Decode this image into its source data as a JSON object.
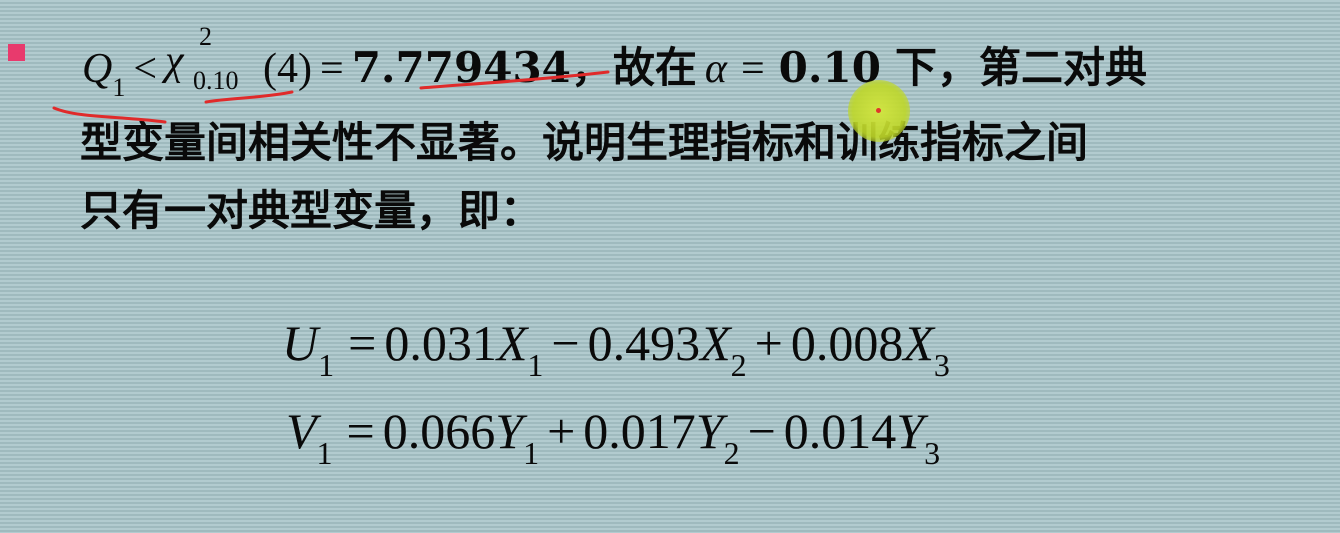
{
  "slide": {
    "line1": {
      "q": "Q",
      "q_sub": "1",
      "lt": "<",
      "chi": "χ",
      "chi_sup": "2",
      "chi_sub": "0.10",
      "arg": "(4)",
      "eq": "=",
      "value": "7.779434",
      "text_a": "，故在",
      "alpha": "α",
      "eq2": "=",
      "alpha_value": "0.10",
      "text_b": "下，第二对典"
    },
    "line2": "型变量间相关性不显著。说明生理指标和训练指标之间",
    "line3": "只有一对典型变量，即：",
    "eq1": {
      "lhs": "U",
      "lhs_sub": "1",
      "eq": "=",
      "t1": "0.031",
      "v1": "X",
      "s1": "1",
      "op1": "−",
      "t2": "0.493",
      "v2": "X",
      "s2": "2",
      "op2": "+",
      "t3": "0.008",
      "v3": "X",
      "s3": "3"
    },
    "eq2": {
      "lhs": "V",
      "lhs_sub": "1",
      "eq": "=",
      "t1": "0.066",
      "v1": "Y",
      "s1": "1",
      "op1": "+",
      "t2": "0.017",
      "v2": "Y",
      "s2": "2",
      "op2": "−",
      "t3": "0.014",
      "v3": "Y",
      "s3": "3"
    }
  },
  "colors": {
    "bullet": "#e83a6d",
    "ink_annotation": "#e02a2a",
    "pointer": "#c9dd3a"
  }
}
